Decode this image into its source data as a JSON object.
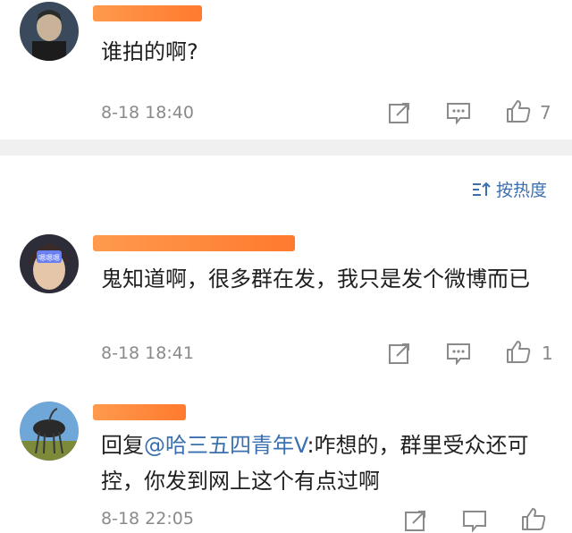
{
  "comments": [
    {
      "text": "谁拍的啊?",
      "time": "8-18 18:40",
      "likes": "7"
    },
    {
      "text": "鬼知道啊，很多群在发，我只是发个微博而已",
      "time": "8-18 18:41",
      "likes": "1",
      "avatar_label": "嗯嗯嗯"
    },
    {
      "reply_prefix": "回复",
      "reply_target": "@哈三五四青年V",
      "reply_text": ":咋想的，群里受众还可控，你发到网上这个有点过啊",
      "time": "8-18 22:05"
    }
  ],
  "sort": {
    "label": "按热度",
    "icon": "sort-icon"
  },
  "colors": {
    "accent": "#3a6fb0",
    "meta": "#8a8a8a",
    "redaction": "#ff8a3d"
  }
}
